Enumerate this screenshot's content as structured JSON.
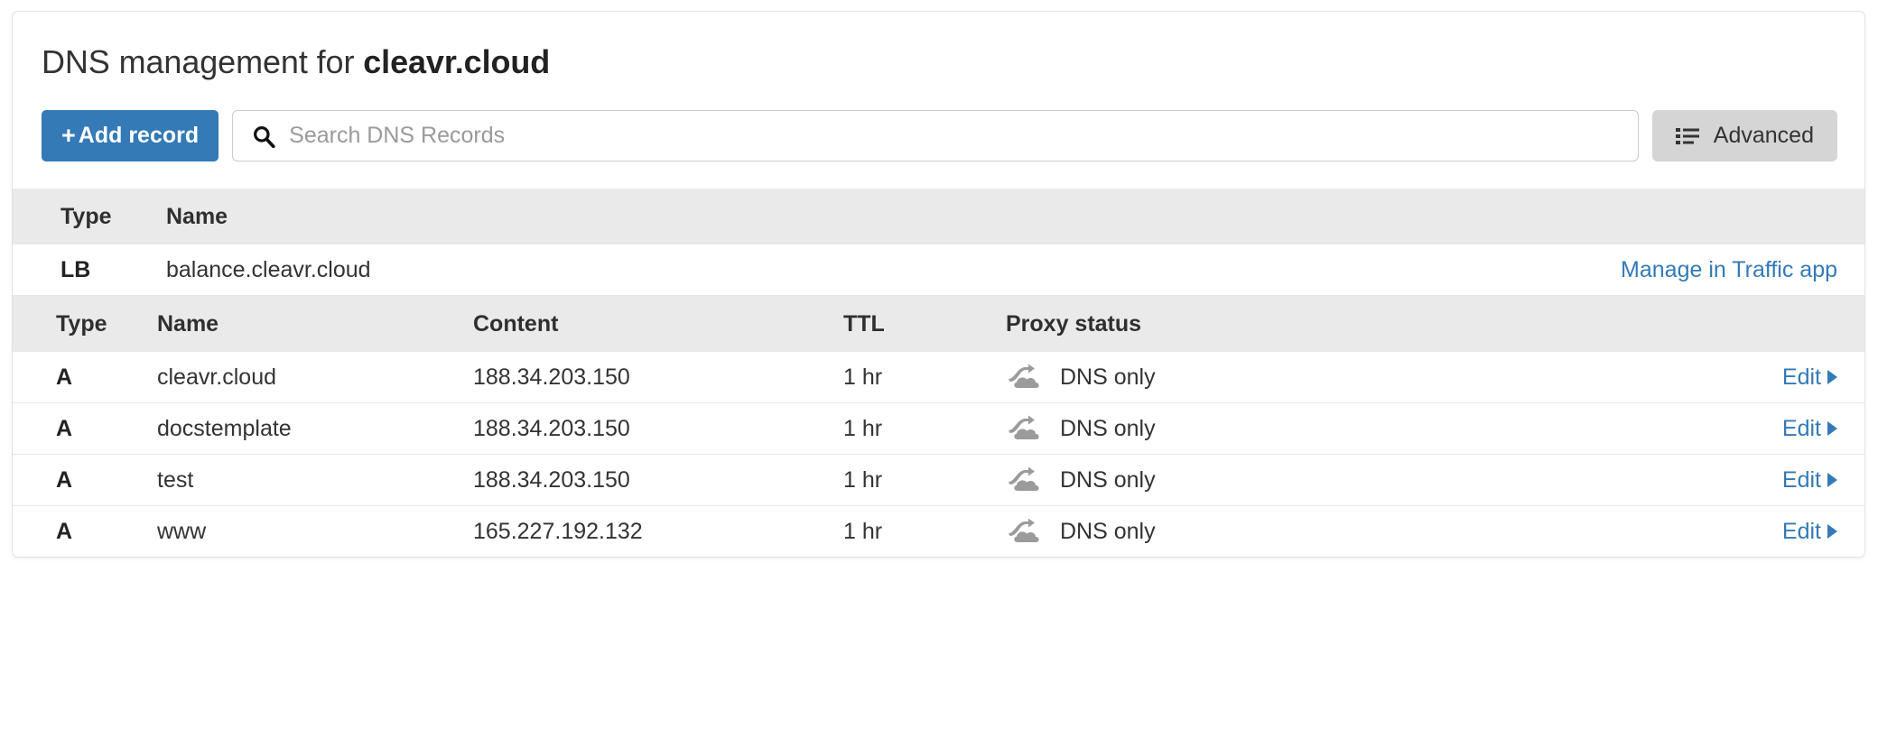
{
  "header": {
    "title_prefix": "DNS management for ",
    "domain": "cleavr.cloud"
  },
  "toolbar": {
    "add_record_label": "Add record",
    "add_record_plus": "+",
    "search_placeholder": "Search DNS Records",
    "search_value": "",
    "advanced_label": "Advanced"
  },
  "lb_table": {
    "headers": {
      "type": "Type",
      "name": "Name"
    },
    "rows": [
      {
        "type": "LB",
        "name": "balance.cleavr.cloud",
        "action": "Manage in Traffic app"
      }
    ]
  },
  "records_table": {
    "headers": {
      "type": "Type",
      "name": "Name",
      "content": "Content",
      "ttl": "TTL",
      "proxy_status": "Proxy status"
    },
    "edit_label": "Edit",
    "rows": [
      {
        "type": "A",
        "name": "cleavr.cloud",
        "content": "188.34.203.150",
        "ttl": "1 hr",
        "proxy_status": "DNS only"
      },
      {
        "type": "A",
        "name": "docstemplate",
        "content": "188.34.203.150",
        "ttl": "1 hr",
        "proxy_status": "DNS only"
      },
      {
        "type": "A",
        "name": "test",
        "content": "188.34.203.150",
        "ttl": "1 hr",
        "proxy_status": "DNS only"
      },
      {
        "type": "A",
        "name": "www",
        "content": "165.227.192.132",
        "ttl": "1 hr",
        "proxy_status": "DNS only"
      }
    ]
  },
  "colors": {
    "primary_blue": "#337ab7",
    "link_blue": "#337ab7",
    "header_gray": "#eaeaea",
    "advanced_gray": "#d5d5d5",
    "proxy_icon_gray": "#9b9b9b"
  },
  "icons": {
    "search": "search-icon",
    "advanced_list": "list-icon",
    "proxy_dns_only": "cloud-arrow-icon",
    "edit_caret": "caret-right-icon"
  }
}
